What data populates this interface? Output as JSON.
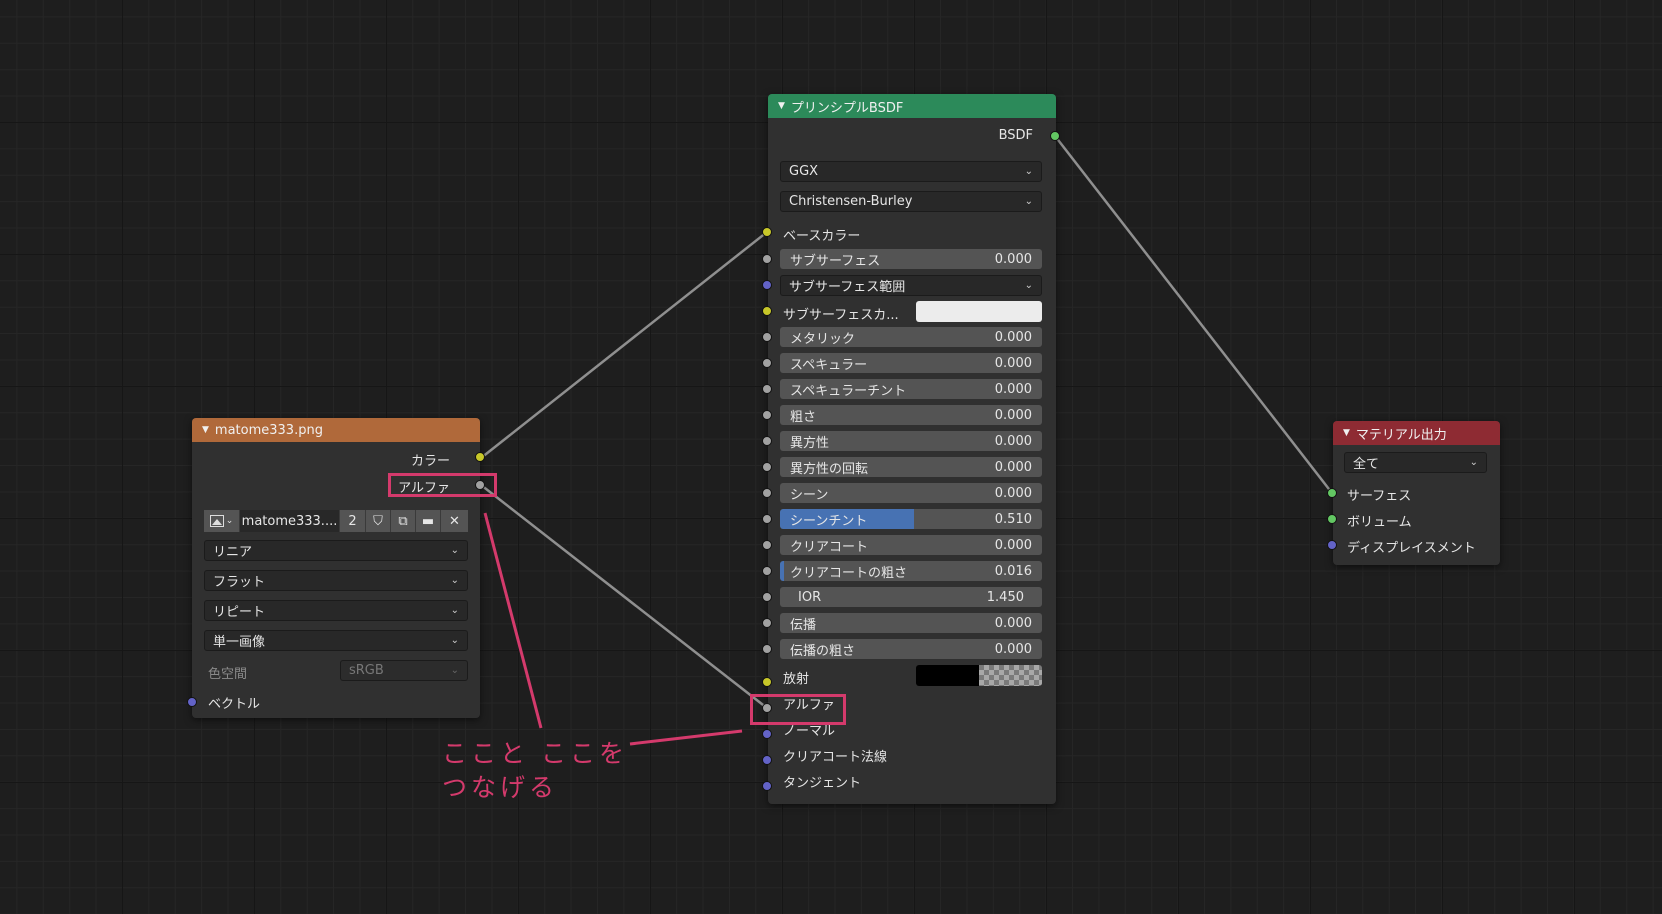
{
  "image_node": {
    "title": "matome333.png",
    "header_color": "#b0693a",
    "outputs": {
      "color": "カラー",
      "alpha": "アルファ"
    },
    "image_name": "matome333....",
    "user_count": "2",
    "icons": [
      "image-icon",
      "shield-icon",
      "duplicate-icon",
      "folder-icon",
      "close-icon"
    ],
    "interpolation": "リニア",
    "projection": "フラット",
    "extension": "リピート",
    "source": "単一画像",
    "colorspace_label": "色空間",
    "colorspace_value": "sRGB",
    "vector_label": "ベクトル"
  },
  "bsdf_node": {
    "title": "プリンシプルBSDF",
    "header_color": "#2c8a5a",
    "output": "BSDF",
    "distribution": "GGX",
    "subsurface_method": "Christensen-Burley",
    "base_color": "ベースカラー",
    "subsurface": {
      "label": "サブサーフェス",
      "value": "0.000"
    },
    "subsurface_radius": "サブサーフェス範囲",
    "subsurface_color": "サブサーフェスカ...",
    "metallic": {
      "label": "メタリック",
      "value": "0.000"
    },
    "specular": {
      "label": "スペキュラー",
      "value": "0.000"
    },
    "specular_tint": {
      "label": "スペキュラーチント",
      "value": "0.000"
    },
    "roughness": {
      "label": "粗さ",
      "value": "0.000"
    },
    "anisotropic": {
      "label": "異方性",
      "value": "0.000"
    },
    "anisotropic_rotation": {
      "label": "異方性の回転",
      "value": "0.000"
    },
    "sheen": {
      "label": "シーン",
      "value": "0.000"
    },
    "sheen_tint": {
      "label": "シーンチント",
      "value": "0.510",
      "fraction": 0.51
    },
    "clearcoat": {
      "label": "クリアコート",
      "value": "0.000"
    },
    "clearcoat_roughness": {
      "label": "クリアコートの粗さ",
      "value": "0.016",
      "fraction": 0.016
    },
    "ior": {
      "label": "IOR",
      "value": "1.450"
    },
    "transmission": {
      "label": "伝播",
      "value": "0.000"
    },
    "transmission_roughness": {
      "label": "伝播の粗さ",
      "value": "0.000"
    },
    "emission": "放射",
    "alpha": "アルファ",
    "normal": "ノーマル",
    "clearcoat_normal": "クリアコート法線",
    "tangent": "タンジェント"
  },
  "output_node": {
    "title": "マテリアル出力",
    "header_color": "#8e2b33",
    "target": "全て",
    "surface": "サーフェス",
    "volume": "ボリューム",
    "displacement": "ディスプレイスメント"
  },
  "annotation": {
    "line1": "ここと ここを",
    "line2": "つなげる",
    "color": "#d43a6c"
  }
}
